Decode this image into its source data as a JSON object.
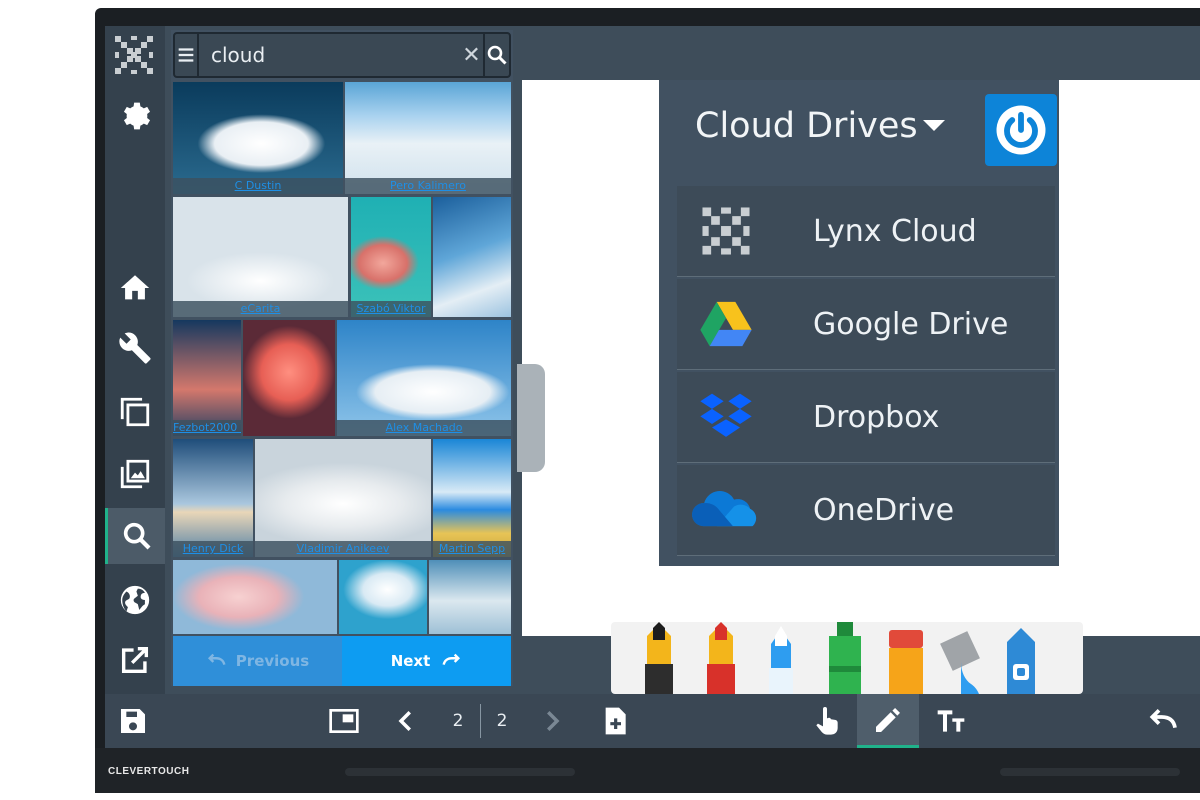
{
  "search": {
    "query": "cloud"
  },
  "results": {
    "captions": [
      "C Dustin",
      "Pero Kalimero",
      "eCarita",
      "Szabó Viktor",
      "Fezbot2000 Vinck",
      "Alex Machado",
      "Henry Dick",
      "Vladimir Anikeev",
      "Martin Sepp"
    ]
  },
  "pager": {
    "previous_label": "Previous",
    "next_label": "Next"
  },
  "cloud_drives": {
    "title": "Cloud Drives",
    "items": [
      {
        "label": "Lynx Cloud",
        "icon": "lynx-cloud-icon"
      },
      {
        "label": "Google Drive",
        "icon": "google-drive-icon"
      },
      {
        "label": "Dropbox",
        "icon": "dropbox-icon"
      },
      {
        "label": "OneDrive",
        "icon": "onedrive-icon"
      }
    ]
  },
  "toolbar": {
    "current_page": "2",
    "total_pages": "2"
  },
  "device": {
    "brand": "CLEVERTOUCH"
  },
  "colors": {
    "accent": "#20b28a",
    "panel": "#415161",
    "next_button": "#0d9cf2",
    "power_button": "#0d84d8"
  }
}
